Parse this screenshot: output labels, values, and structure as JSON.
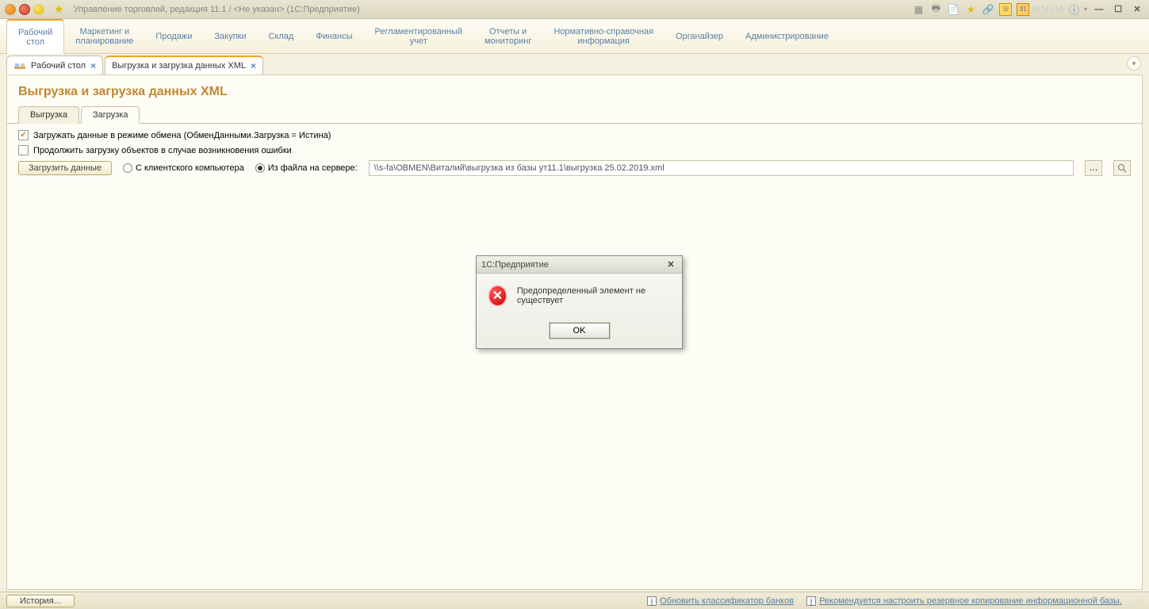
{
  "titlebar": {
    "title": "Управление торговлей, редакция 11.1 / <Не указан>  (1С:Предприятие)",
    "m_labels": [
      "M",
      "M+",
      "M-"
    ],
    "cal_day": "31"
  },
  "mainnav": [
    "Рабочий\nстол",
    "Маркетинг и\nпланирование",
    "Продажи",
    "Закупки",
    "Склад",
    "Финансы",
    "Регламентированный\nучет",
    "Отчеты и\nмониторинг",
    "Нормативно-справочная\nинформация",
    "Органайзер",
    "Администрирование"
  ],
  "tabs": [
    {
      "label": "Рабочий стол",
      "active": false,
      "icon": true
    },
    {
      "label": "Выгрузка и загрузка данных XML",
      "active": true,
      "icon": false
    }
  ],
  "page": {
    "title": "Выгрузка и загрузка данных XML",
    "subtabs": [
      "Выгрузка",
      "Загрузка"
    ],
    "active_subtab": 1,
    "checkbox1": {
      "checked": true,
      "label": "Загружать данные в режиме обмена (ОбменДанными.Загрузка = Истина)"
    },
    "checkbox2": {
      "checked": false,
      "label": "Продолжить загрузку объектов в случае возникновения ошибки"
    },
    "load_button": "Загрузить данные",
    "radio1": "С клиентского компьютера",
    "radio2": "Из файла на сервере:",
    "radio_selected": 2,
    "path": "\\\\s-fa\\OBMEN\\Виталий\\выгрузка из базы ут11.1\\выгрузка 25.02.2019.xml"
  },
  "dialog": {
    "title": "1С:Предприятие",
    "message": "Предопределенный элемент не существует",
    "ok": "OK"
  },
  "statusbar": {
    "history": "История...",
    "link1": "Обновить классификатор банков",
    "link2": "Рекомендуется настроить резервное копирование информационной базы."
  }
}
